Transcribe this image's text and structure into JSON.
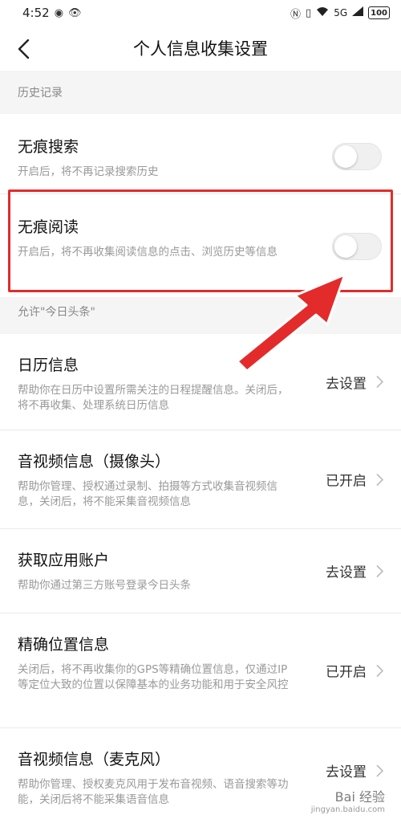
{
  "status_bar": {
    "time": "4:52",
    "network": "5G",
    "battery": "100"
  },
  "nav": {
    "title": "个人信息收集设置"
  },
  "history_section": {
    "header": "历史记录",
    "items": [
      {
        "title": "无痕搜索",
        "desc": "开启后，将不再记录搜索历史",
        "enabled": false
      },
      {
        "title": "无痕阅读",
        "desc": "开启后，将不再收集阅读信息的点击、浏览历史等信息",
        "enabled": false
      }
    ]
  },
  "permissions_section": {
    "header": "允许\"今日头条\"",
    "items": [
      {
        "title": "日历信息",
        "desc": "帮助你在日历中设置所需关注的日程提醒信息。关闭后，将不再收集、处理系统日历信息",
        "action": "去设置"
      },
      {
        "title": "音视频信息（摄像头）",
        "desc": "帮助你管理、授权通过录制、拍摄等方式收集音视频信息，关闭后，将不能采集音视频信息",
        "action": "已开启"
      },
      {
        "title": "获取应用账户",
        "desc": "帮助你通过第三方账号登录今日头条",
        "action": "去设置"
      },
      {
        "title": "精确位置信息",
        "desc": "关闭后，将不再收集你的GPS等精确位置信息，仅通过IP等定位大致的位置以保障基本的业务功能和用于安全风控",
        "action": "已开启"
      },
      {
        "title": "音视频信息（麦克风）",
        "desc": "帮助你管理、授权麦克风用于发布音视频、语音搜索等功能，关闭后将不能采集语音信息",
        "action": "去设置"
      }
    ]
  },
  "watermark": {
    "text": "Bai 经验",
    "sub": "jingyan.baidu.com"
  },
  "colors": {
    "highlight": "#e32b2b",
    "section_bg": "#f5f5f5",
    "desc_text": "#999999"
  }
}
